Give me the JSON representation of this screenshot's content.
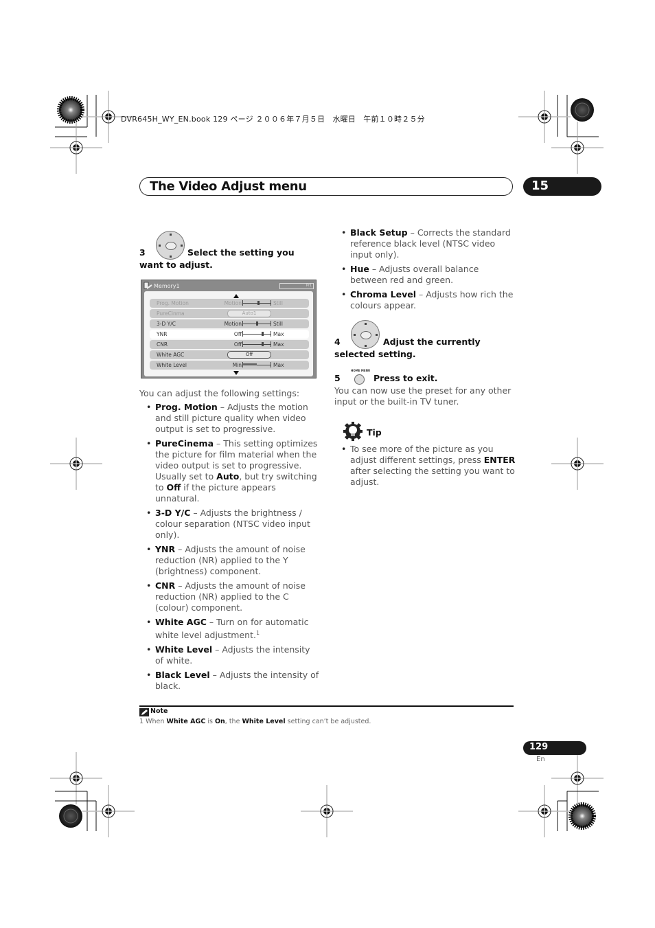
{
  "print_header": "DVR645H_WY_EN.book  129 ページ  ２００６年７月５日　水曜日　午前１０時２５分",
  "chapter": {
    "title": "The Video Adjust menu",
    "number": "15"
  },
  "step3": {
    "number": "3",
    "text": "Select the setting you want to adjust.",
    "icon": "dpad-enter-icon",
    "center_label": "ENTER"
  },
  "osd": {
    "title": "Memory1",
    "preset_label": "Pr1",
    "rows": [
      {
        "label": "Prog. Motion",
        "left": "Motion",
        "right": "Still",
        "type": "slider",
        "value": 0.55,
        "state": "dim"
      },
      {
        "label": "PureCinma",
        "value_text": "Auto1",
        "type": "option",
        "state": "dim"
      },
      {
        "label": "3-D Y/C",
        "left": "Motion",
        "right": "Still",
        "type": "slider",
        "value": 0.5,
        "state": "normal"
      },
      {
        "label": "YNR",
        "left": "Off",
        "right": "Max",
        "type": "slider",
        "value": 0.7,
        "state": "selected"
      },
      {
        "label": "CNR",
        "left": "Off",
        "right": "Max",
        "type": "slider",
        "value": 0.7,
        "state": "normal"
      },
      {
        "label": "White AGC",
        "value_text": "Off",
        "type": "option",
        "state": "normal"
      },
      {
        "label": "White Level",
        "left": "Min",
        "right": "Max",
        "type": "fill",
        "value": 0.5,
        "state": "normal"
      }
    ]
  },
  "intro": "You can adjust the following settings:",
  "settings_left": [
    {
      "name": "Prog. Motion",
      "desc": " – Adjusts the motion and still picture quality when video output is set to progressive."
    },
    {
      "name": "PureCinema",
      "desc": " – This setting optimizes the picture for film material when the video output is set to progressive. Usually set to ",
      "b1": "Auto",
      "mid": ", but try switching to ",
      "b2": "Off",
      "end": " if the picture appears unnatural."
    },
    {
      "name": "3-D Y/C",
      "desc": " – Adjusts the brightness / colour separation (NTSC video input only)."
    },
    {
      "name": "YNR",
      "desc": " – Adjusts the amount of noise reduction (NR) applied to the Y (brightness) component."
    },
    {
      "name": "CNR",
      "desc": " – Adjusts the amount of noise reduction (NR) applied to the C (colour) component."
    },
    {
      "name": "White AGC",
      "desc": " – Turn on for automatic white level adjustment.",
      "footnote": "1"
    },
    {
      "name": "White Level",
      "desc": " – Adjusts the intensity of white."
    },
    {
      "name": "Black Level",
      "desc": " – Adjusts the intensity of black."
    }
  ],
  "settings_right": [
    {
      "name": "Black Setup",
      "desc": " – Corrects the standard reference black level (NTSC video input only)."
    },
    {
      "name": "Hue",
      "desc": " – Adjusts overall balance between red and green."
    },
    {
      "name": "Chroma Level",
      "desc": " – Adjusts how rich the colours appear."
    }
  ],
  "step4": {
    "number": "4",
    "text": "Adjust the currently selected setting.",
    "center_label": "ENTER"
  },
  "step5": {
    "number": "5",
    "button_label": "HOME MENU",
    "text": "Press to exit.",
    "body": "You can now use the preset for any other input or the built-in TV tuner."
  },
  "tip": {
    "title": "Tip",
    "pre": "To see more of the picture as you adjust different settings, press ",
    "bold": "ENTER",
    "post": " after selecting the setting you want to adjust."
  },
  "note": {
    "title": "Note",
    "num": "1",
    "p1": " When ",
    "b1": "White AGC",
    "p2": " is ",
    "b2": "On",
    "p3": ", the ",
    "b3": "White Level",
    "p4": " setting can’t be adjusted."
  },
  "page": {
    "number": "129",
    "lang": "En"
  }
}
